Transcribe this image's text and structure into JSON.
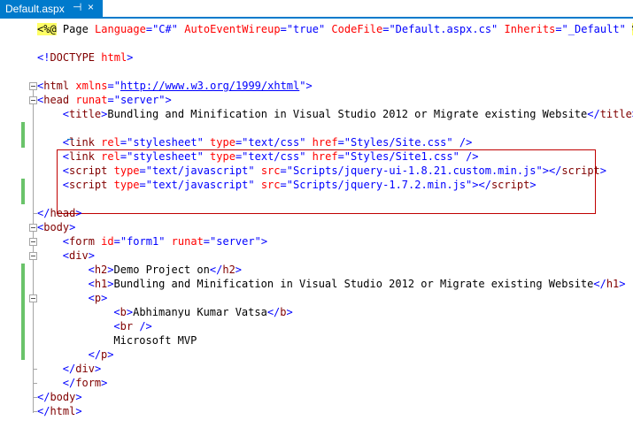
{
  "tab": {
    "label": "Default.aspx",
    "pin_glyph": "⊣",
    "close_glyph": "×"
  },
  "colors": {
    "accent": "#007acc",
    "tag": "#800000",
    "attr": "#ff0000",
    "value": "#0000ff",
    "directive_highlight": "#ffff66",
    "change_bar": "#6ac36a",
    "highlight_box": "#c00000"
  },
  "lines": [
    {
      "indent": 0,
      "tokens": [
        [
          "dir",
          "<%@"
        ],
        [
          "txt",
          " Page "
        ],
        [
          "a",
          "Language"
        ],
        [
          "d",
          "="
        ],
        [
          "v",
          "\"C#\""
        ],
        [
          "txt",
          " "
        ],
        [
          "a",
          "AutoEventWireup"
        ],
        [
          "d",
          "="
        ],
        [
          "v",
          "\"true\""
        ],
        [
          "txt",
          " "
        ],
        [
          "a",
          "CodeFile"
        ],
        [
          "d",
          "="
        ],
        [
          "v",
          "\"Default.aspx.cs\""
        ],
        [
          "txt",
          " "
        ],
        [
          "a",
          "Inherits"
        ],
        [
          "d",
          "="
        ],
        [
          "v",
          "\"_Default\""
        ],
        [
          "txt",
          " "
        ],
        [
          "dir",
          "%>"
        ]
      ]
    },
    {
      "indent": 0,
      "tokens": []
    },
    {
      "indent": 0,
      "tokens": [
        [
          "d",
          "<!"
        ],
        [
          "t",
          "DOCTYPE"
        ],
        [
          "txt",
          " "
        ],
        [
          "a",
          "html"
        ],
        [
          "d",
          ">"
        ]
      ]
    },
    {
      "indent": 0,
      "tokens": []
    },
    {
      "indent": 0,
      "tokens": [
        [
          "d",
          "<"
        ],
        [
          "t",
          "html"
        ],
        [
          "txt",
          " "
        ],
        [
          "a",
          "xmlns"
        ],
        [
          "d",
          "="
        ],
        [
          "d",
          "\""
        ],
        [
          "u",
          "http://www.w3.org/1999/xhtml"
        ],
        [
          "d",
          "\""
        ],
        [
          "d",
          ">"
        ]
      ]
    },
    {
      "indent": 0,
      "tokens": [
        [
          "d",
          "<"
        ],
        [
          "t",
          "head"
        ],
        [
          "txt",
          " "
        ],
        [
          "a",
          "runat"
        ],
        [
          "d",
          "="
        ],
        [
          "v",
          "\"server\""
        ],
        [
          "d",
          ">"
        ]
      ]
    },
    {
      "indent": 4,
      "tokens": [
        [
          "d",
          "<"
        ],
        [
          "t",
          "title"
        ],
        [
          "d",
          ">"
        ],
        [
          "txt",
          "Bundling and Minification in Visual Studio 2012 or Migrate existing Website"
        ],
        [
          "d",
          "</"
        ],
        [
          "t",
          "title"
        ],
        [
          "d",
          ">"
        ]
      ]
    },
    {
      "indent": 0,
      "tokens": []
    },
    {
      "indent": 4,
      "tokens": [
        [
          "d",
          "<"
        ],
        [
          "t",
          "link"
        ],
        [
          "txt",
          " "
        ],
        [
          "a",
          "rel"
        ],
        [
          "d",
          "="
        ],
        [
          "v",
          "\"stylesheet\""
        ],
        [
          "txt",
          " "
        ],
        [
          "a",
          "type"
        ],
        [
          "d",
          "="
        ],
        [
          "v",
          "\"text/css\""
        ],
        [
          "txt",
          " "
        ],
        [
          "a",
          "href"
        ],
        [
          "d",
          "="
        ],
        [
          "v",
          "\"Styles/Site.css\""
        ],
        [
          "txt",
          " "
        ],
        [
          "d",
          "/>"
        ]
      ]
    },
    {
      "indent": 4,
      "tokens": [
        [
          "d",
          "<"
        ],
        [
          "t",
          "link"
        ],
        [
          "txt",
          " "
        ],
        [
          "a",
          "rel"
        ],
        [
          "d",
          "="
        ],
        [
          "v",
          "\"stylesheet\""
        ],
        [
          "txt",
          " "
        ],
        [
          "a",
          "type"
        ],
        [
          "d",
          "="
        ],
        [
          "v",
          "\"text/css\""
        ],
        [
          "txt",
          " "
        ],
        [
          "a",
          "href"
        ],
        [
          "d",
          "="
        ],
        [
          "v",
          "\"Styles/Site1.css\""
        ],
        [
          "txt",
          " "
        ],
        [
          "d",
          "/>"
        ]
      ]
    },
    {
      "indent": 4,
      "tokens": [
        [
          "d",
          "<"
        ],
        [
          "t",
          "script"
        ],
        [
          "txt",
          " "
        ],
        [
          "a",
          "type"
        ],
        [
          "d",
          "="
        ],
        [
          "v",
          "\"text/javascript\""
        ],
        [
          "txt",
          " "
        ],
        [
          "a",
          "src"
        ],
        [
          "d",
          "="
        ],
        [
          "v",
          "\"Scripts/jquery-ui-1.8.21.custom.min.js\""
        ],
        [
          "d",
          "></"
        ],
        [
          "t",
          "script"
        ],
        [
          "d",
          ">"
        ]
      ]
    },
    {
      "indent": 4,
      "tokens": [
        [
          "d",
          "<"
        ],
        [
          "t",
          "script"
        ],
        [
          "txt",
          " "
        ],
        [
          "a",
          "type"
        ],
        [
          "d",
          "="
        ],
        [
          "v",
          "\"text/javascript\""
        ],
        [
          "txt",
          " "
        ],
        [
          "a",
          "src"
        ],
        [
          "d",
          "="
        ],
        [
          "v",
          "\"Scripts/jquery-1.7.2.min.js\""
        ],
        [
          "d",
          "></"
        ],
        [
          "t",
          "script"
        ],
        [
          "d",
          ">"
        ]
      ]
    },
    {
      "indent": 0,
      "tokens": []
    },
    {
      "indent": 0,
      "tokens": [
        [
          "d",
          "</"
        ],
        [
          "t",
          "head"
        ],
        [
          "d",
          ">"
        ]
      ]
    },
    {
      "indent": 0,
      "tokens": [
        [
          "d",
          "<"
        ],
        [
          "t",
          "body"
        ],
        [
          "d",
          ">"
        ]
      ]
    },
    {
      "indent": 4,
      "tokens": [
        [
          "d",
          "<"
        ],
        [
          "t",
          "form"
        ],
        [
          "txt",
          " "
        ],
        [
          "a",
          "id"
        ],
        [
          "d",
          "="
        ],
        [
          "v",
          "\"form1\""
        ],
        [
          "txt",
          " "
        ],
        [
          "a",
          "runat"
        ],
        [
          "d",
          "="
        ],
        [
          "v",
          "\"server\""
        ],
        [
          "d",
          ">"
        ]
      ]
    },
    {
      "indent": 4,
      "tokens": [
        [
          "d",
          "<"
        ],
        [
          "t",
          "div"
        ],
        [
          "d",
          ">"
        ]
      ]
    },
    {
      "indent": 8,
      "tokens": [
        [
          "d",
          "<"
        ],
        [
          "t",
          "h2"
        ],
        [
          "d",
          ">"
        ],
        [
          "txt",
          "Demo Project on"
        ],
        [
          "d",
          "</"
        ],
        [
          "t",
          "h2"
        ],
        [
          "d",
          ">"
        ]
      ]
    },
    {
      "indent": 8,
      "tokens": [
        [
          "d",
          "<"
        ],
        [
          "t",
          "h1"
        ],
        [
          "d",
          ">"
        ],
        [
          "txt",
          "Bundling and Minification in Visual Studio 2012 or Migrate existing Website"
        ],
        [
          "d",
          "</"
        ],
        [
          "t",
          "h1"
        ],
        [
          "d",
          ">"
        ]
      ]
    },
    {
      "indent": 8,
      "tokens": [
        [
          "d",
          "<"
        ],
        [
          "t",
          "p"
        ],
        [
          "d",
          ">"
        ]
      ]
    },
    {
      "indent": 12,
      "tokens": [
        [
          "d",
          "<"
        ],
        [
          "t",
          "b"
        ],
        [
          "d",
          ">"
        ],
        [
          "txt",
          "Abhimanyu Kumar Vatsa"
        ],
        [
          "d",
          "</"
        ],
        [
          "t",
          "b"
        ],
        [
          "d",
          ">"
        ]
      ]
    },
    {
      "indent": 12,
      "tokens": [
        [
          "d",
          "<"
        ],
        [
          "t",
          "br"
        ],
        [
          "txt",
          " "
        ],
        [
          "d",
          "/>"
        ]
      ]
    },
    {
      "indent": 12,
      "tokens": [
        [
          "txt",
          "Microsoft MVP"
        ]
      ]
    },
    {
      "indent": 8,
      "tokens": [
        [
          "d",
          "</"
        ],
        [
          "t",
          "p"
        ],
        [
          "d",
          ">"
        ]
      ]
    },
    {
      "indent": 4,
      "tokens": [
        [
          "d",
          "</"
        ],
        [
          "t",
          "div"
        ],
        [
          "d",
          ">"
        ]
      ]
    },
    {
      "indent": 4,
      "tokens": [
        [
          "d",
          "</"
        ],
        [
          "t",
          "form"
        ],
        [
          "d",
          ">"
        ]
      ]
    },
    {
      "indent": 0,
      "tokens": [
        [
          "d",
          "</"
        ],
        [
          "t",
          "body"
        ],
        [
          "d",
          ">"
        ]
      ]
    },
    {
      "indent": 0,
      "tokens": [
        [
          "d",
          "</"
        ],
        [
          "t",
          "html"
        ],
        [
          "d",
          ">"
        ]
      ]
    }
  ]
}
